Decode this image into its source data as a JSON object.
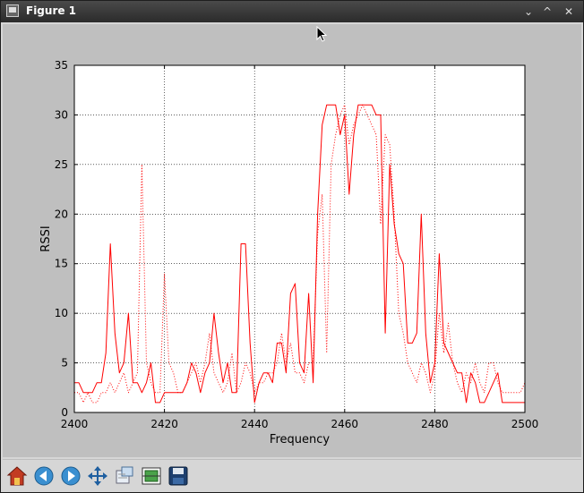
{
  "window": {
    "title": "Figure 1",
    "controls": [
      "⌄",
      "^",
      "✕"
    ]
  },
  "toolbar": {
    "tools": [
      {
        "name": "home-icon",
        "label": "Home"
      },
      {
        "name": "back-icon",
        "label": "Back"
      },
      {
        "name": "forward-icon",
        "label": "Forward"
      },
      {
        "name": "pan-icon",
        "label": "Pan"
      },
      {
        "name": "zoom-icon",
        "label": "Zoom"
      },
      {
        "name": "subplots-icon",
        "label": "Subplots"
      },
      {
        "name": "save-icon",
        "label": "Save"
      }
    ]
  },
  "chart_data": {
    "type": "line",
    "title": "",
    "xlabel": "Frequency",
    "ylabel": "RSSI",
    "xlim": [
      2400,
      2500
    ],
    "ylim": [
      0,
      35
    ],
    "xticks": [
      2400,
      2420,
      2440,
      2460,
      2480,
      2500
    ],
    "yticks": [
      0,
      5,
      10,
      15,
      20,
      25,
      30,
      35
    ],
    "grid": true,
    "series": [
      {
        "style": "solid",
        "color": "#ff0000",
        "x": [
          2400,
          2401,
          2402,
          2403,
          2404,
          2405,
          2406,
          2407,
          2408,
          2409,
          2410,
          2411,
          2412,
          2413,
          2414,
          2415,
          2416,
          2417,
          2418,
          2419,
          2420,
          2421,
          2422,
          2423,
          2424,
          2425,
          2426,
          2427,
          2428,
          2429,
          2430,
          2431,
          2432,
          2433,
          2434,
          2435,
          2436,
          2437,
          2438,
          2439,
          2440,
          2441,
          2442,
          2443,
          2444,
          2445,
          2446,
          2447,
          2448,
          2449,
          2450,
          2451,
          2452,
          2453,
          2454,
          2455,
          2456,
          2457,
          2458,
          2459,
          2460,
          2461,
          2462,
          2463,
          2464,
          2465,
          2466,
          2467,
          2468,
          2469,
          2470,
          2471,
          2472,
          2473,
          2474,
          2475,
          2476,
          2477,
          2478,
          2479,
          2480,
          2481,
          2482,
          2483,
          2484,
          2485,
          2486,
          2487,
          2488,
          2489,
          2490,
          2491,
          2492,
          2493,
          2494,
          2495,
          2496,
          2497,
          2498,
          2499,
          2500
        ],
        "y": [
          3,
          3,
          2,
          2,
          2,
          3,
          3,
          6,
          17,
          8,
          4,
          5,
          10,
          3,
          3,
          2,
          3,
          5,
          1,
          1,
          2,
          2,
          2,
          2,
          2,
          3,
          5,
          4,
          2,
          4,
          5,
          10,
          6,
          3,
          5,
          2,
          2,
          17,
          17,
          7,
          1,
          3,
          4,
          4,
          3,
          7,
          7,
          4,
          12,
          13,
          5,
          4,
          12,
          3,
          20,
          29,
          31,
          31,
          31,
          28,
          30,
          22,
          28,
          31,
          31,
          31,
          31,
          30,
          30,
          8,
          25,
          19,
          16,
          15,
          7,
          7,
          8,
          20,
          8,
          3,
          5,
          16,
          7,
          6,
          5,
          4,
          4,
          1,
          4,
          3,
          1,
          1,
          2,
          3,
          4,
          1,
          1,
          1,
          1,
          1,
          1
        ]
      },
      {
        "style": "dotted",
        "color": "#ff0000",
        "x": [
          2400,
          2401,
          2402,
          2403,
          2404,
          2405,
          2406,
          2407,
          2408,
          2409,
          2410,
          2411,
          2412,
          2413,
          2414,
          2415,
          2416,
          2417,
          2418,
          2419,
          2420,
          2421,
          2422,
          2423,
          2424,
          2425,
          2426,
          2427,
          2428,
          2429,
          2430,
          2431,
          2432,
          2433,
          2434,
          2435,
          2436,
          2437,
          2438,
          2439,
          2440,
          2441,
          2442,
          2443,
          2444,
          2445,
          2446,
          2447,
          2448,
          2449,
          2450,
          2451,
          2452,
          2453,
          2454,
          2455,
          2456,
          2457,
          2458,
          2459,
          2460,
          2461,
          2462,
          2463,
          2464,
          2465,
          2466,
          2467,
          2468,
          2469,
          2470,
          2471,
          2472,
          2473,
          2474,
          2475,
          2476,
          2477,
          2478,
          2479,
          2480,
          2481,
          2482,
          2483,
          2484,
          2485,
          2486,
          2487,
          2488,
          2489,
          2490,
          2491,
          2492,
          2493,
          2494,
          2495,
          2496,
          2497,
          2498,
          2499,
          2500
        ],
        "y": [
          2,
          2,
          1,
          2,
          1,
          1,
          2,
          2,
          3,
          2,
          3,
          4,
          2,
          3,
          4,
          25,
          5,
          3,
          2,
          2,
          14,
          5,
          4,
          2,
          2,
          3,
          4,
          5,
          3,
          5,
          8,
          4,
          3,
          2,
          3,
          6,
          2,
          3,
          5,
          4,
          2,
          3,
          3,
          4,
          4,
          5,
          8,
          5,
          7,
          4,
          4,
          3,
          5,
          5,
          18,
          22,
          6,
          25,
          28,
          30,
          31,
          27,
          29,
          30,
          31,
          30,
          29,
          28,
          19,
          28,
          27,
          20,
          10,
          8,
          5,
          4,
          3,
          5,
          4,
          2,
          4,
          10,
          6,
          9,
          5,
          3,
          2,
          4,
          3,
          5,
          3,
          2,
          5,
          5,
          3,
          2,
          2,
          2,
          2,
          2,
          3
        ]
      }
    ]
  }
}
